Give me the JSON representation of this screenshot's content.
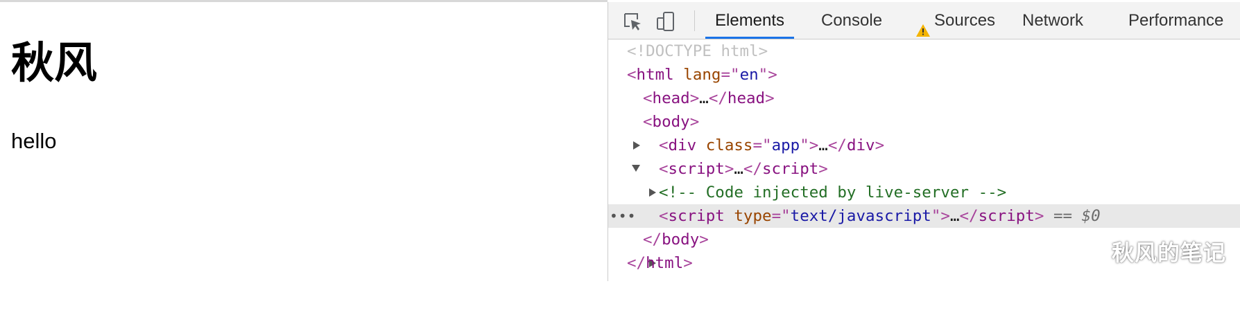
{
  "page": {
    "heading": "秋风",
    "paragraph": "hello"
  },
  "devtools": {
    "toolbar": {
      "inspect_icon": "element-picker-icon",
      "device_icon": "device-toggle-icon",
      "warning_icon": "warning-icon",
      "warning_color": "#f4b400",
      "accent_color": "#1a73e8"
    },
    "tabs": [
      {
        "label": "Elements",
        "active": true
      },
      {
        "label": "Console"
      },
      {
        "label": "Sources",
        "warning": true
      },
      {
        "label": "Network"
      },
      {
        "label": "Performance"
      }
    ],
    "dom": {
      "doctype": "<!DOCTYPE html>",
      "html_tag": "html",
      "html_attr": "lang",
      "html_attr_value": "en",
      "head_tag": "head",
      "body_tag": "body",
      "div_tag": "div",
      "div_attr": "class",
      "div_attr_value": "app",
      "script_tag": "script",
      "comment": "<!-- Code injected by live-server -->",
      "script2_attr": "type",
      "script2_attr_value": "text/javascript",
      "ellipsis": "…",
      "selected_marker": "== ",
      "selected_var": "$0",
      "row_dots": "•••"
    }
  },
  "watermark": "秋风的笔记"
}
